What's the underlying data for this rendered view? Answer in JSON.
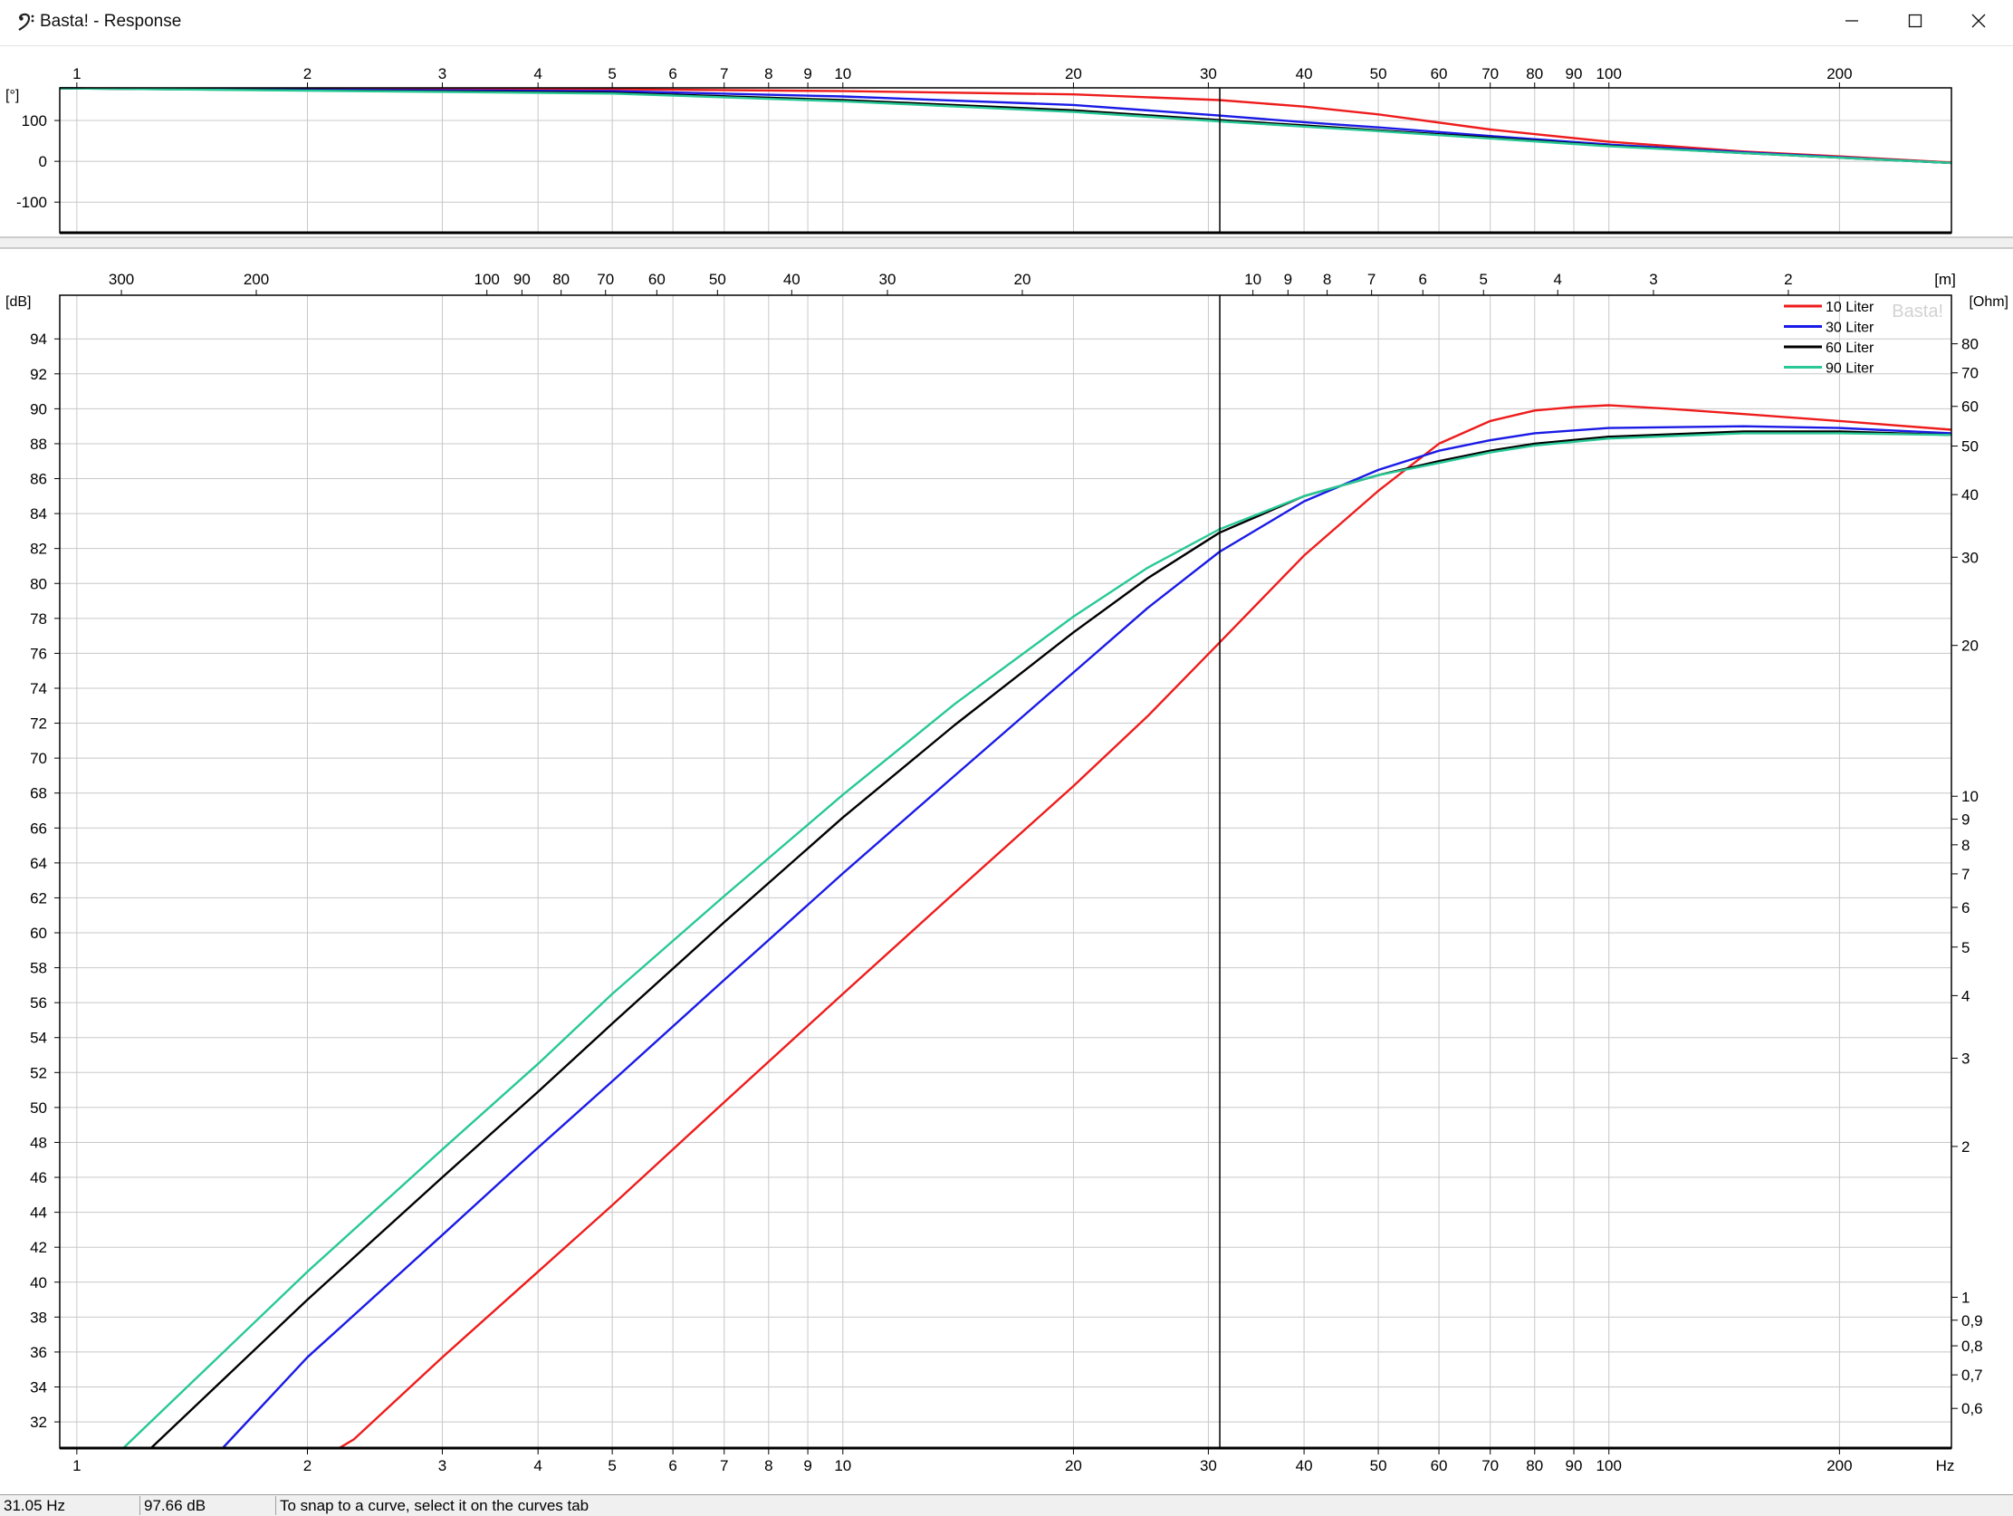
{
  "window": {
    "title": "Basta! - Response",
    "icon": "bass-clef-icon",
    "controls": [
      "minimize-icon",
      "maximize-icon",
      "close-icon"
    ]
  },
  "statusbar": {
    "frequency": "31.05 Hz",
    "level": "97.66 dB",
    "message": "To snap to a curve, select it on the curves tab"
  },
  "watermark": "Basta!",
  "colors": {
    "10 Liter": "#ee1c1c",
    "30 Liter": "#1a1ae6",
    "60 Liter": "#000000",
    "90 Liter": "#28c896",
    "grid": "#c8c8c8",
    "cursor": "#000000"
  },
  "chart_data": [
    {
      "type": "line",
      "name": "phase",
      "ylabel": "[°]",
      "xscale": "log",
      "xlim": [
        0.95,
        280
      ],
      "ylim": [
        -175,
        180
      ],
      "x_ticks": [
        1,
        2,
        3,
        4,
        5,
        6,
        7,
        8,
        9,
        10,
        20,
        30,
        40,
        50,
        60,
        70,
        80,
        90,
        100,
        200
      ],
      "y_ticks": [
        -100,
        0,
        100
      ],
      "grid": true,
      "cursor_x": 31.05,
      "series": [
        {
          "name": "10 Liter",
          "points": [
            [
              0.95,
              179
            ],
            [
              5,
              177
            ],
            [
              10,
              172
            ],
            [
              20,
              164
            ],
            [
              31,
              150
            ],
            [
              40,
              134
            ],
            [
              50,
              115
            ],
            [
              70,
              78
            ],
            [
              100,
              48
            ],
            [
              150,
              24
            ],
            [
              200,
              12
            ],
            [
              280,
              -3
            ]
          ]
        },
        {
          "name": "30 Liter",
          "points": [
            [
              0.95,
              179
            ],
            [
              5,
              172
            ],
            [
              10,
              159
            ],
            [
              20,
              138
            ],
            [
              31,
              112
            ],
            [
              40,
              96
            ],
            [
              50,
              83
            ],
            [
              70,
              62
            ],
            [
              100,
              41
            ],
            [
              150,
              22
            ],
            [
              200,
              10
            ],
            [
              280,
              -4
            ]
          ]
        },
        {
          "name": "60 Liter",
          "points": [
            [
              0.95,
              179
            ],
            [
              5,
              168
            ],
            [
              10,
              150
            ],
            [
              20,
              125
            ],
            [
              31,
              101
            ],
            [
              40,
              88
            ],
            [
              50,
              76
            ],
            [
              70,
              58
            ],
            [
              100,
              38
            ],
            [
              150,
              20
            ],
            [
              200,
              9
            ],
            [
              280,
              -4
            ]
          ]
        },
        {
          "name": "90 Liter",
          "points": [
            [
              0.95,
              179
            ],
            [
              5,
              166
            ],
            [
              10,
              147
            ],
            [
              20,
              121
            ],
            [
              31,
              98
            ],
            [
              40,
              85
            ],
            [
              50,
              74
            ],
            [
              70,
              56
            ],
            [
              100,
              37
            ],
            [
              150,
              20
            ],
            [
              200,
              9
            ],
            [
              280,
              -4
            ]
          ]
        }
      ]
    },
    {
      "type": "line",
      "name": "response",
      "ylabel": "[dB]",
      "y2label": "[Ohm]",
      "xlabel": "Hz",
      "x2label": "[m]",
      "xscale": "log",
      "xlim": [
        0.95,
        280
      ],
      "ylim": [
        30.5,
        96.5
      ],
      "x_ticks": [
        1,
        2,
        3,
        4,
        5,
        6,
        7,
        8,
        9,
        10,
        20,
        30,
        40,
        50,
        60,
        70,
        80,
        90,
        100,
        200
      ],
      "y_ticks": [
        32,
        34,
        36,
        38,
        40,
        42,
        44,
        46,
        48,
        50,
        52,
        54,
        56,
        58,
        60,
        62,
        64,
        66,
        68,
        70,
        72,
        74,
        76,
        78,
        80,
        82,
        84,
        86,
        88,
        90,
        92,
        94
      ],
      "wavelength_ticks": [
        "300",
        "200",
        "100",
        "90",
        "80",
        "70",
        "60",
        "50",
        "40",
        "30",
        "20",
        "10",
        "9",
        "8",
        "7",
        "6",
        "5",
        "4",
        "3",
        "2"
      ],
      "wavelength_values": [
        300,
        200,
        100,
        90,
        80,
        70,
        60,
        50,
        40,
        30,
        20,
        10,
        9,
        8,
        7,
        6,
        5,
        4,
        3,
        2
      ],
      "ohm_ticks": [
        {
          "label": "80",
          "value": 80
        },
        {
          "label": "70",
          "value": 70
        },
        {
          "label": "60",
          "value": 60
        },
        {
          "label": "50",
          "value": 50
        },
        {
          "label": "40",
          "value": 40
        },
        {
          "label": "30",
          "value": 30
        },
        {
          "label": "20",
          "value": 20
        },
        {
          "label": "10",
          "value": 10
        },
        {
          "label": "9",
          "value": 9
        },
        {
          "label": "8",
          "value": 8
        },
        {
          "label": "7",
          "value": 7
        },
        {
          "label": "6",
          "value": 6
        },
        {
          "label": "5",
          "value": 5
        },
        {
          "label": "4",
          "value": 4
        },
        {
          "label": "3",
          "value": 3
        },
        {
          "label": "2",
          "value": 2
        },
        {
          "label": "1",
          "value": 1
        },
        {
          "label": "0,9",
          "value": 0.9
        },
        {
          "label": "0,8",
          "value": 0.8
        },
        {
          "label": "0,7",
          "value": 0.7
        },
        {
          "label": "0,6",
          "value": 0.6
        }
      ],
      "ohm_scale": "log",
      "ohm_lim": [
        0.5,
        100
      ],
      "grid": true,
      "legend": "top-right",
      "cursor_x": 31.05,
      "series": [
        {
          "name": "10 Liter",
          "points": [
            [
              0.95,
              30.5
            ],
            [
              2.2,
              30.5
            ],
            [
              2.3,
              31
            ],
            [
              3,
              35.7
            ],
            [
              4,
              40.6
            ],
            [
              5,
              44.4
            ],
            [
              7,
              50.3
            ],
            [
              10,
              56.5
            ],
            [
              14,
              62.3
            ],
            [
              20,
              68.4
            ],
            [
              25,
              72.4
            ],
            [
              31,
              76.6
            ],
            [
              40,
              81.6
            ],
            [
              50,
              85.3
            ],
            [
              60,
              88.0
            ],
            [
              70,
              89.3
            ],
            [
              80,
              89.9
            ],
            [
              90,
              90.1
            ],
            [
              100,
              90.2
            ],
            [
              120,
              90.0
            ],
            [
              150,
              89.7
            ],
            [
              200,
              89.3
            ],
            [
              280,
              88.8
            ]
          ]
        },
        {
          "name": "30 Liter",
          "points": [
            [
              0.95,
              30.5
            ],
            [
              1.55,
              30.5
            ],
            [
              2,
              35.7
            ],
            [
              3,
              42.7
            ],
            [
              4,
              47.7
            ],
            [
              5,
              51.5
            ],
            [
              7,
              57.3
            ],
            [
              10,
              63.4
            ],
            [
              14,
              69.0
            ],
            [
              20,
              74.9
            ],
            [
              25,
              78.6
            ],
            [
              31,
              81.8
            ],
            [
              40,
              84.7
            ],
            [
              50,
              86.5
            ],
            [
              60,
              87.6
            ],
            [
              70,
              88.2
            ],
            [
              80,
              88.6
            ],
            [
              100,
              88.9
            ],
            [
              150,
              89.0
            ],
            [
              200,
              88.9
            ],
            [
              280,
              88.6
            ]
          ]
        },
        {
          "name": "60 Liter",
          "points": [
            [
              0.95,
              30.5
            ],
            [
              1.25,
              30.5
            ],
            [
              2,
              39.0
            ],
            [
              3,
              46.0
            ],
            [
              4,
              50.9
            ],
            [
              5,
              54.8
            ],
            [
              7,
              60.6
            ],
            [
              10,
              66.6
            ],
            [
              14,
              71.9
            ],
            [
              20,
              77.2
            ],
            [
              25,
              80.3
            ],
            [
              31,
              82.9
            ],
            [
              40,
              85.0
            ],
            [
              50,
              86.2
            ],
            [
              60,
              87.0
            ],
            [
              70,
              87.6
            ],
            [
              80,
              88.0
            ],
            [
              100,
              88.4
            ],
            [
              150,
              88.7
            ],
            [
              200,
              88.7
            ],
            [
              280,
              88.5
            ]
          ]
        },
        {
          "name": "90 Liter",
          "points": [
            [
              0.95,
              30.5
            ],
            [
              1.15,
              30.5
            ],
            [
              2,
              40.6
            ],
            [
              3,
              47.6
            ],
            [
              4,
              52.5
            ],
            [
              5,
              56.5
            ],
            [
              7,
              62.1
            ],
            [
              10,
              67.9
            ],
            [
              14,
              73.1
            ],
            [
              20,
              78.1
            ],
            [
              25,
              80.9
            ],
            [
              31,
              83.1
            ],
            [
              40,
              85.0
            ],
            [
              50,
              86.2
            ],
            [
              60,
              86.9
            ],
            [
              70,
              87.5
            ],
            [
              80,
              87.9
            ],
            [
              100,
              88.3
            ],
            [
              150,
              88.6
            ],
            [
              200,
              88.6
            ],
            [
              280,
              88.5
            ]
          ]
        }
      ]
    }
  ]
}
